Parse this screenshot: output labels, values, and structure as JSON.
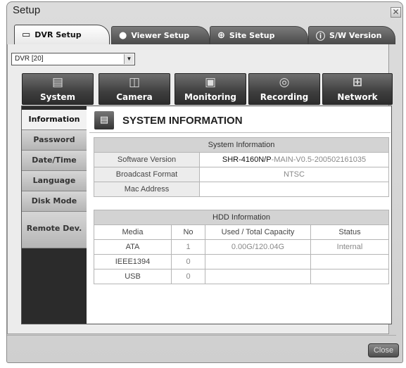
{
  "window": {
    "title": "Setup",
    "close_glyph": "✕"
  },
  "tabs": [
    {
      "label": "DVR Setup",
      "icon": "dvr-setup-icon",
      "glyph": "▭"
    },
    {
      "label": "Viewer Setup",
      "icon": "viewer-setup-icon",
      "glyph": "●"
    },
    {
      "label": "Site Setup",
      "icon": "site-setup-icon",
      "glyph": "⊕"
    },
    {
      "label": "S/W Version",
      "icon": "info-icon",
      "glyph": "ⓘ"
    }
  ],
  "dvr_select": {
    "value": "DVR [20]"
  },
  "categories": [
    {
      "label": "System",
      "glyph": "▤"
    },
    {
      "label": "Camera",
      "glyph": "◫"
    },
    {
      "label": "Monitoring",
      "glyph": "▣"
    },
    {
      "label": "Recording",
      "glyph": "◎"
    },
    {
      "label": "Network",
      "glyph": "⊞"
    }
  ],
  "sidebar": {
    "items": [
      "Information",
      "Password",
      "Date/Time",
      "Language",
      "Disk Mode",
      "Remote Dev."
    ]
  },
  "header": {
    "title": "SYSTEM INFORMATION",
    "glyph": "▤"
  },
  "system_info": {
    "caption": "System Information",
    "rows": [
      {
        "label": "Software Version",
        "value_strong": "SHR-4160N/P",
        "value_dim": "-MAIN-V0.5-200502161035"
      },
      {
        "label": "Broadcast Format",
        "value": "NTSC"
      },
      {
        "label": "Mac Address",
        "value": ""
      }
    ]
  },
  "hdd_info": {
    "caption": "HDD Information",
    "columns": [
      "Media",
      "No",
      "Used / Total Capacity",
      "Status"
    ],
    "rows": [
      [
        "ATA",
        "1",
        "0.00G/120.04G",
        "Internal"
      ],
      [
        "IEEE1394",
        "0",
        "",
        ""
      ],
      [
        "USB",
        "0",
        "",
        ""
      ]
    ]
  },
  "footer": {
    "close_label": "Close"
  }
}
